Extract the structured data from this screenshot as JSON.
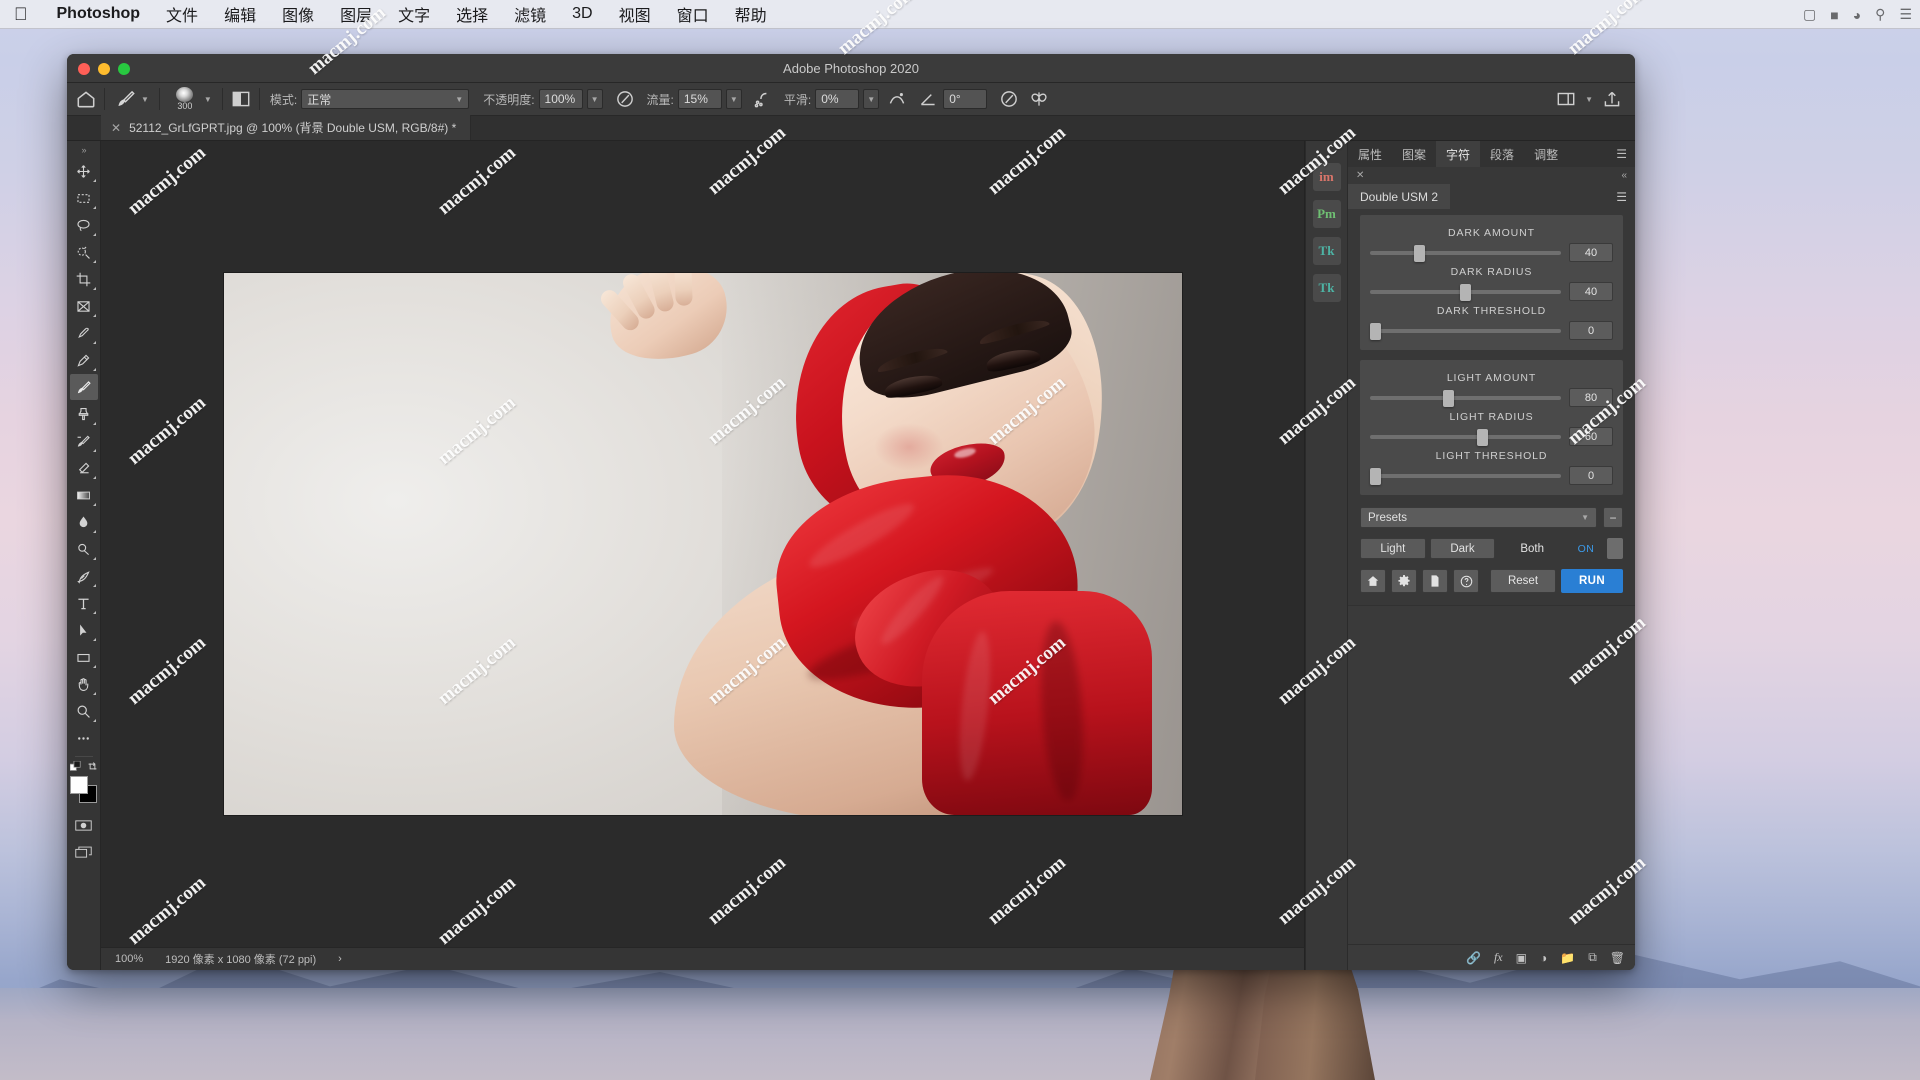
{
  "menubar": {
    "apple_icon": "apple-logo",
    "items": [
      {
        "label": "Photoshop",
        "bold": true
      },
      {
        "label": "文件",
        "bold": false
      },
      {
        "label": "编辑",
        "bold": false
      },
      {
        "label": "图像",
        "bold": false
      },
      {
        "label": "图层",
        "bold": false
      },
      {
        "label": "文字",
        "bold": false
      },
      {
        "label": "选择",
        "bold": false
      },
      {
        "label": "滤镜",
        "bold": false
      },
      {
        "label": "3D",
        "bold": false
      },
      {
        "label": "视图",
        "bold": false
      },
      {
        "label": "窗口",
        "bold": false
      },
      {
        "label": "帮助",
        "bold": false
      }
    ],
    "status_icons": [
      "screenshot-icon",
      "battery-icon",
      "wifi-icon",
      "search-icon",
      "control-center-icon"
    ]
  },
  "window": {
    "title": "Adobe Photoshop 2020",
    "traffic_lights": [
      "close-button",
      "minimize-button",
      "maximize-button"
    ]
  },
  "options_bar": {
    "home_icon": "home-icon",
    "tool_preset_icon": "brush-tool-icon",
    "brush_size": "300",
    "brush_preset_icon": "brush-preview-icon",
    "airbrush_toggle_icon": "airbrush-icon",
    "mode_label": "模式:",
    "mode_value": "正常",
    "opacity_label": "不透明度:",
    "opacity_value": "100%",
    "opacity_pressure_icon": "pressure-opacity-icon",
    "flow_label": "流量:",
    "flow_value": "15%",
    "airbrush_icon": "airbrush-toggle-icon",
    "smoothing_label": "平滑:",
    "smoothing_value": "0%",
    "smoothing_options_icon": "smoothing-options-icon",
    "angle_label": "",
    "angle_value": "0°",
    "pressure_size_icon": "pressure-size-icon",
    "symmetry_icon": "symmetry-butterfly-icon",
    "right_icons": [
      "panel-switch-icon",
      "chevron-down-icon",
      "share-icon"
    ]
  },
  "document_tab": {
    "close_icon": "close-icon",
    "title": "52112_GrLfGPRT.jpg @ 100% (背景 Double USM, RGB/8#) *"
  },
  "toolbar": {
    "handle_icon": "double-chevron-right-icon",
    "tools": [
      {
        "name": "move-tool",
        "icon": "move-icon",
        "active": false
      },
      {
        "name": "rectangular-marquee-tool",
        "icon": "marquee-icon",
        "active": false
      },
      {
        "name": "lasso-tool",
        "icon": "lasso-icon",
        "active": false
      },
      {
        "name": "quick-selection-tool",
        "icon": "quick-select-icon",
        "active": false
      },
      {
        "name": "crop-tool",
        "icon": "crop-icon",
        "active": false
      },
      {
        "name": "frame-tool",
        "icon": "frame-icon",
        "active": false
      },
      {
        "name": "eyedropper-tool",
        "icon": "eyedropper-icon",
        "active": false
      },
      {
        "name": "spot-healing-brush-tool",
        "icon": "healing-brush-icon",
        "active": false
      },
      {
        "name": "brush-tool",
        "icon": "brush-icon",
        "active": true
      },
      {
        "name": "clone-stamp-tool",
        "icon": "clone-stamp-icon",
        "active": false
      },
      {
        "name": "history-brush-tool",
        "icon": "history-brush-icon",
        "active": false
      },
      {
        "name": "eraser-tool",
        "icon": "eraser-icon",
        "active": false
      },
      {
        "name": "gradient-tool",
        "icon": "gradient-icon",
        "active": false
      },
      {
        "name": "blur-tool",
        "icon": "blur-droplet-icon",
        "active": false
      },
      {
        "name": "dodge-tool",
        "icon": "dodge-icon",
        "active": false
      },
      {
        "name": "pen-tool",
        "icon": "pen-icon",
        "active": false
      },
      {
        "name": "type-tool",
        "icon": "type-t-icon",
        "active": false
      },
      {
        "name": "path-selection-tool",
        "icon": "path-arrow-icon",
        "active": false
      },
      {
        "name": "rectangle-tool",
        "icon": "rectangle-icon",
        "active": false
      },
      {
        "name": "hand-tool",
        "icon": "hand-icon",
        "active": false
      },
      {
        "name": "zoom-tool",
        "icon": "magnifier-icon",
        "active": false
      },
      {
        "name": "edit-toolbar-button",
        "icon": "ellipsis-icon",
        "active": false
      }
    ],
    "swap_icon": "swap-colors-icon",
    "default_colors_icon": "default-colors-icon",
    "foreground_color": "#ffffff",
    "background_color": "#000000",
    "quick_mask_icon": "quick-mask-icon",
    "screen_mode_icon": "screen-mode-icon"
  },
  "status_bar": {
    "zoom": "100%",
    "doc_size": "1920 像素 x 1080 像素 (72 ppi)",
    "arrow_icon": "chevron-right-icon"
  },
  "extension_rail": {
    "collapse_icon": "double-chevron-right-icon",
    "buttons": [
      {
        "name": "imagenomic-extension",
        "label": "im",
        "color": "#d9756a"
      },
      {
        "name": "portraiture-extension",
        "label": "Pm",
        "color": "#6fbf73"
      },
      {
        "name": "tk-panel-extension-1",
        "label": "Tk",
        "color": "#4db3a4"
      },
      {
        "name": "tk-panel-extension-2",
        "label": "Tk",
        "color": "#4db3a4"
      }
    ]
  },
  "right_panel": {
    "tabs": [
      {
        "label": "属性",
        "active": false
      },
      {
        "label": "图案",
        "active": false
      },
      {
        "label": "字符",
        "active": true
      },
      {
        "label": "段落",
        "active": false
      },
      {
        "label": "调整",
        "active": false
      }
    ],
    "menu_icon": "hamburger-menu-icon",
    "close_icon": "close-icon",
    "collapse_icon": "double-chevron-left-icon",
    "usm": {
      "title": "Double USM 2",
      "panel_menu_icon": "hamburger-menu-icon",
      "dark_sliders": [
        {
          "label": "DARK AMOUNT",
          "value": "40",
          "pct": 23
        },
        {
          "label": "DARK RADIUS",
          "value": "40",
          "pct": 47
        },
        {
          "label": "DARK THRESHOLD",
          "value": "0",
          "pct": 1
        }
      ],
      "light_sliders": [
        {
          "label": "LIGHT AMOUNT",
          "value": "80",
          "pct": 38
        },
        {
          "label": "LIGHT RADIUS",
          "value": "60",
          "pct": 56
        },
        {
          "label": "LIGHT THRESHOLD",
          "value": "0",
          "pct": 1
        }
      ],
      "presets_label": "Presets",
      "presets_caret_icon": "caret-down-icon",
      "presets_minus_label": "−",
      "segments": [
        {
          "label": "Light",
          "style": "button"
        },
        {
          "label": "Dark",
          "style": "button"
        },
        {
          "label": "Both",
          "style": "plain"
        }
      ],
      "on_label": "ON",
      "action_icons": [
        {
          "name": "home-button",
          "icon": "home-icon"
        },
        {
          "name": "settings-button",
          "icon": "gear-icon"
        },
        {
          "name": "document-button",
          "icon": "document-icon"
        },
        {
          "name": "help-button",
          "icon": "question-circle-icon"
        }
      ],
      "reset_label": "Reset",
      "run_label": "RUN",
      "accent_color": "#2a7fd4"
    },
    "footer_icons": [
      "link-layers-icon",
      "fx-icon",
      "layer-mask-icon",
      "adjustment-layer-icon",
      "new-group-icon",
      "new-layer-icon",
      "delete-layer-icon"
    ]
  },
  "watermark": {
    "text": "macmj.com",
    "count": 26
  }
}
